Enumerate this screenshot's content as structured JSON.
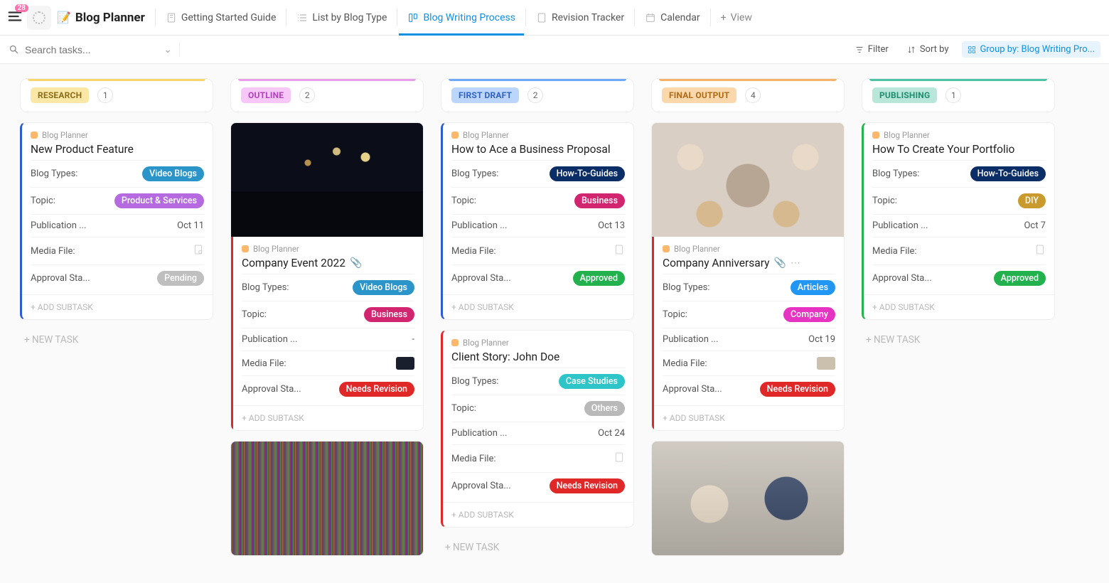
{
  "notifications_count": "28",
  "page_title": "Blog Planner",
  "nav": [
    {
      "label": "Getting Started Guide",
      "active": false,
      "icon": "doc-pin"
    },
    {
      "label": "List by Blog Type",
      "active": false,
      "icon": "list"
    },
    {
      "label": "Blog Writing Process",
      "active": true,
      "icon": "board"
    },
    {
      "label": "Revision Tracker",
      "active": false,
      "icon": "doc"
    },
    {
      "label": "Calendar",
      "active": false,
      "icon": "calendar"
    }
  ],
  "add_view_label": "View",
  "search_placeholder": "Search tasks...",
  "toolbar": {
    "filter": "Filter",
    "sort": "Sort by",
    "group": "Group by: Blog Writing Pro..."
  },
  "labels": {
    "breadcrumb": "Blog Planner",
    "blog_types": "Blog Types:",
    "topic": "Topic:",
    "pub_date": "Publication ...",
    "media": "Media File:",
    "approval": "Approval Sta...",
    "add_subtask": "+ ADD SUBTASK",
    "new_task": "+ NEW TASK"
  },
  "chips": {
    "video_blogs": {
      "text": "Video Blogs",
      "bg": "#2b94c9"
    },
    "how_to": {
      "text": "How-To-Guides",
      "bg": "#0b2e66"
    },
    "articles": {
      "text": "Articles",
      "bg": "#2196f3"
    },
    "case_studies": {
      "text": "Case Studies",
      "bg": "#2dc5c8"
    },
    "product_services": {
      "text": "Product & Services",
      "bg": "#b66ae0"
    },
    "business": {
      "text": "Business",
      "bg": "#d1266f"
    },
    "company": {
      "text": "Company",
      "bg": "#e733c1"
    },
    "others": {
      "text": "Others",
      "bg": "#b9b9b9"
    },
    "diy": {
      "text": "DIY",
      "bg": "#c99a2e"
    },
    "pending": {
      "text": "Pending",
      "bg": "#bfbfbf"
    },
    "approved": {
      "text": "Approved",
      "bg": "#22b14c"
    },
    "needs_revision": {
      "text": "Needs Revision",
      "bg": "#e02828"
    }
  },
  "columns": [
    {
      "id": "research",
      "label": "RESEARCH",
      "count": "1"
    },
    {
      "id": "outline",
      "label": "OUTLINE",
      "count": "2"
    },
    {
      "id": "first",
      "label": "FIRST DRAFT",
      "count": "2"
    },
    {
      "id": "final",
      "label": "FINAL OUTPUT",
      "count": "4"
    },
    {
      "id": "pub",
      "label": "PUBLISHING",
      "count": "1"
    }
  ],
  "cards": {
    "research": [
      {
        "title": "New Product Feature",
        "accent": "blue",
        "blog_type": "video_blogs",
        "topic": "product_services",
        "pub": "Oct 11",
        "media": "icon",
        "approval": "pending"
      }
    ],
    "outline": [
      {
        "title": "Company Event 2022",
        "accent": "red",
        "img": "concert",
        "attach": true,
        "blog_type": "video_blogs",
        "topic": "business",
        "pub": "-",
        "media": "thumb",
        "approval": "needs_revision"
      }
    ],
    "first": [
      {
        "title": "How to Ace a Business Proposal",
        "accent": "blue",
        "blog_type": "how_to",
        "topic": "business",
        "pub": "Oct 13",
        "media": "icon",
        "approval": "approved"
      },
      {
        "title": "Client Story: John Doe",
        "accent": "red",
        "blog_type": "case_studies",
        "topic": "others",
        "pub": "Oct 24",
        "media": "icon",
        "approval": "needs_revision"
      }
    ],
    "final": [
      {
        "title": "Company Anniversary",
        "accent": "red",
        "img": "team",
        "attach": true,
        "more": true,
        "blog_type": "articles",
        "topic": "company",
        "pub": "Oct 19",
        "media": "thumb",
        "approval": "needs_revision"
      }
    ],
    "pub": [
      {
        "title": "How To Create Your Portfolio",
        "accent": "green",
        "blog_type": "how_to",
        "topic": "diy",
        "pub": "Oct 7",
        "media": "icon",
        "approval": "approved"
      }
    ]
  }
}
